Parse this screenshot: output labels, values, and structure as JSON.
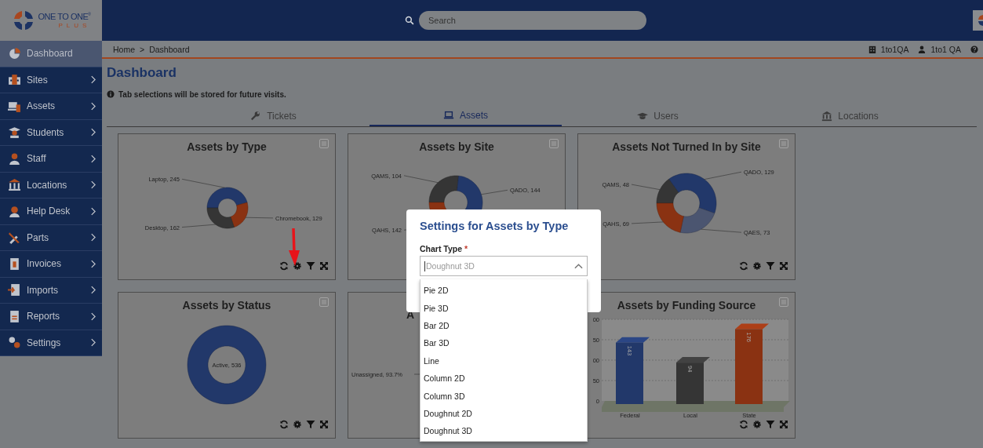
{
  "logo": {
    "line1": "ONE TO ONE$^{®}$",
    "line2": "PLUS"
  },
  "search": {
    "placeholder": "Search"
  },
  "sidebar": {
    "items": [
      {
        "label": "Dashboard",
        "selected": true
      },
      {
        "label": "Sites",
        "selected": false
      },
      {
        "label": "Assets",
        "selected": false
      },
      {
        "label": "Students",
        "selected": false
      },
      {
        "label": "Staff",
        "selected": false
      },
      {
        "label": "Locations",
        "selected": false
      },
      {
        "label": "Help Desk",
        "selected": false
      },
      {
        "label": "Parts",
        "selected": false
      },
      {
        "label": "Invoices",
        "selected": false
      },
      {
        "label": "Imports",
        "selected": false
      },
      {
        "label": "Reports",
        "selected": false
      },
      {
        "label": "Settings",
        "selected": false
      }
    ]
  },
  "breadcrumb": {
    "items": [
      "Home",
      "Dashboard"
    ],
    "separator": ">"
  },
  "user_bar": {
    "site": "1to1QA",
    "user": "1to1 QA"
  },
  "page": {
    "title": "Dashboard",
    "notice": "Tab selections will be stored for future visits."
  },
  "tabs": [
    {
      "label": "Tickets",
      "selected": false
    },
    {
      "label": "Assets",
      "selected": true
    },
    {
      "label": "Users",
      "selected": false
    },
    {
      "label": "Locations",
      "selected": false
    }
  ],
  "cards": [
    {
      "title": "Assets by Type",
      "kind": "donut",
      "annotation": {
        "kind": "arrow"
      },
      "chart_data": {
        "type": "donut",
        "values": [
          245,
          129,
          162
        ],
        "colors": [
          "#22386a",
          "#8a3212",
          "#353535"
        ],
        "value_labels": [
          "Laptop, 245",
          "Chromebook, 129",
          "Desktop, 162"
        ]
      }
    },
    {
      "title": "Assets by Site",
      "kind": "donut",
      "chart_data": {
        "type": "donut",
        "values": [
          104,
          144,
          142
        ],
        "colors": [
          "#353535",
          "#22386a",
          "#8a3212"
        ],
        "value_labels": [
          "QAMS, 104",
          "QADO, 144",
          "QAHS, 142"
        ]
      }
    },
    {
      "title": "Assets Not Turned In by Site",
      "kind": "donut",
      "chart_data": {
        "type": "donut",
        "values": [
          48,
          129,
          73,
          69
        ],
        "colors": [
          "#353535",
          "#22386a",
          "#4b5570",
          "#8a3212"
        ],
        "value_labels": [
          "QAMS, 48",
          "QADO, 129",
          "QAES, 73",
          "QAHS, 69"
        ]
      }
    },
    {
      "title": "Assets by Status",
      "kind": "donut",
      "chart_data": {
        "type": "donut",
        "values": [
          536
        ],
        "colors": [
          "#22386a"
        ],
        "value_labels": [
          "Active, 536"
        ]
      }
    },
    {
      "title": "A",
      "kind": "covered",
      "labels": [
        "Unassigned, 93.7%"
      ]
    },
    {
      "title": "Assets by Funding Source",
      "kind": "bar",
      "tick_fragments": [
        "00",
        "50",
        "00",
        "50",
        "0"
      ],
      "chart_data": {
        "type": "bar",
        "categories": [
          "Federal",
          "Local",
          "State"
        ],
        "values": [
          143,
          94,
          176
        ],
        "colors": [
          "#22386a",
          "#353535",
          "#8a3212"
        ],
        "ylim": [
          0,
          200
        ],
        "grid": true,
        "data_labels": true
      }
    }
  ],
  "modal": {
    "title": "Settings for Assets by Type",
    "field_label": "Chart Type",
    "required_mark": "*",
    "placeholder": "Doughnut 3D",
    "options": [
      "Pie 2D",
      "Pie 3D",
      "Bar 2D",
      "Bar 3D",
      "Line",
      "Column 2D",
      "Column 3D",
      "Doughnut 2D",
      "Doughnut 3D"
    ]
  }
}
